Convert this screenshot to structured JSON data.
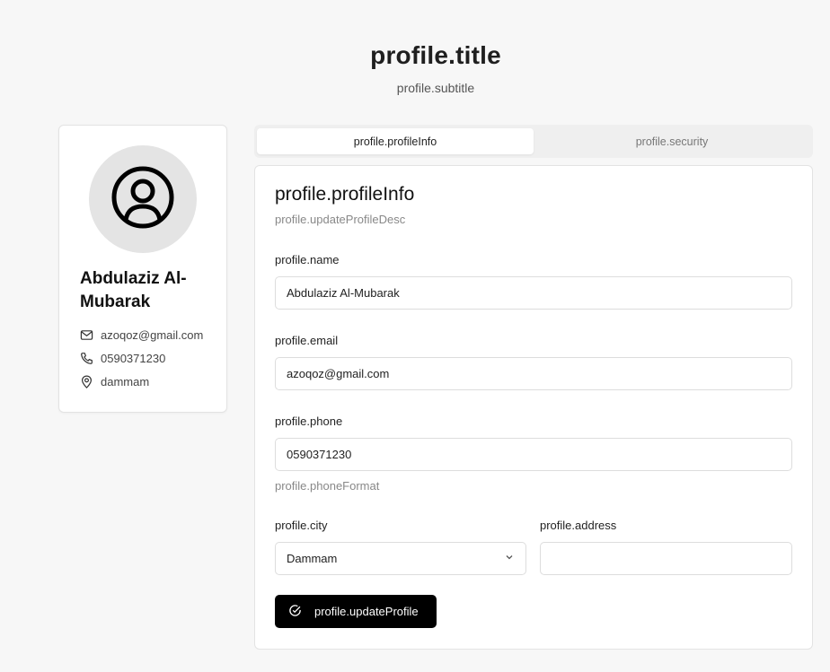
{
  "page": {
    "title": "profile.title",
    "subtitle": "profile.subtitle"
  },
  "profile_card": {
    "avatar_icon": "user-circle-icon",
    "name": "Abdulaziz Al-Mubarak",
    "email": "azoqoz@gmail.com",
    "phone": "0590371230",
    "location": "dammam"
  },
  "tabs": [
    {
      "label": "profile.profileInfo",
      "active": true
    },
    {
      "label": "profile.security",
      "active": false
    }
  ],
  "form": {
    "heading": "profile.profileInfo",
    "description": "profile.updateProfileDesc",
    "name_label": "profile.name",
    "name_value": "Abdulaziz Al-Mubarak",
    "email_label": "profile.email",
    "email_value": "azoqoz@gmail.com",
    "phone_label": "profile.phone",
    "phone_value": "0590371230",
    "phone_hint": "profile.phoneFormat",
    "city_label": "profile.city",
    "city_value": "Dammam",
    "address_label": "profile.address",
    "address_value": "",
    "submit_label": "profile.updateProfile"
  },
  "colors": {
    "background": "#f7f7f7",
    "primary_button": "#000000",
    "avatar_bg": "#e4e4e4"
  }
}
